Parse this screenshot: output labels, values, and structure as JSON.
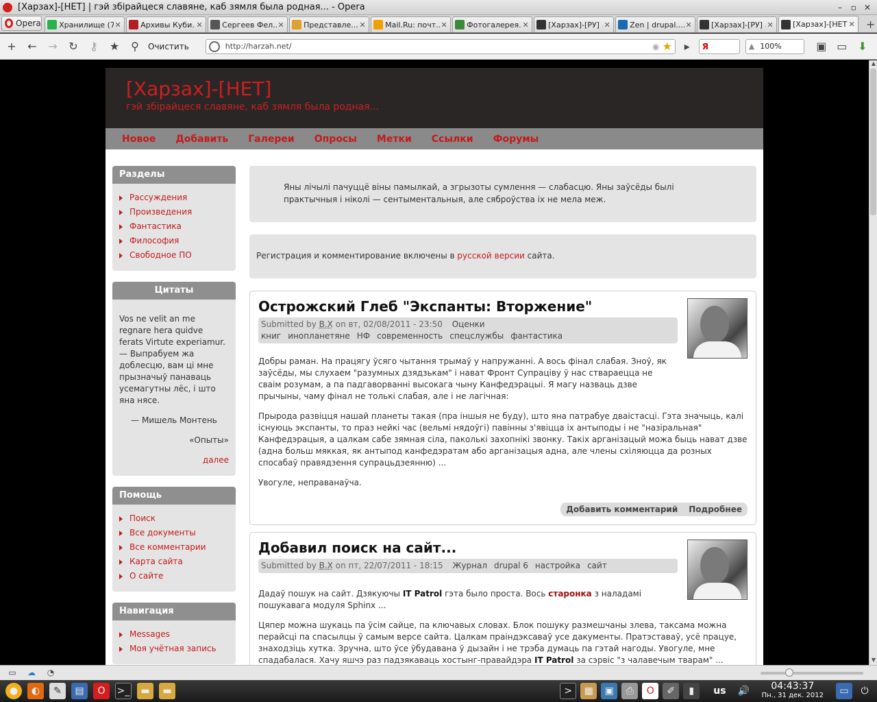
{
  "window": {
    "title": "[Харзах]-[НЕТ] | гэй збірайцеся славяне, каб зямля была родная... - Opera"
  },
  "browser": {
    "menu_label": "Opera",
    "tabs": [
      {
        "label": "Хранилище (7)",
        "color": "#2bb24c"
      },
      {
        "label": "Архивы Куби...",
        "color": "#b02020"
      },
      {
        "label": "Сергеев Фел...",
        "color": "#555555"
      },
      {
        "label": "Представле...",
        "color": "#e0a030"
      },
      {
        "label": "Mail.Ru: почт...",
        "color": "#f0a000"
      },
      {
        "label": "Фотогалерея...",
        "color": "#3a8a3a"
      },
      {
        "label": "[Харзах]-[РУ] ...",
        "color": "#333333"
      },
      {
        "label": "Zen | drupal....",
        "color": "#1a6ab0"
      },
      {
        "label": "[Харзах]-[РУ] ...",
        "color": "#333333"
      },
      {
        "label": "[Харзах]-[НЕТ...",
        "color": "#333333",
        "active": true
      }
    ],
    "toolbar": {
      "clear_label": "Очистить",
      "url": "http://harzah.net/",
      "search_engine": "Я",
      "zoom": "100%"
    }
  },
  "site": {
    "title": "[Харзах]-[НЕТ]",
    "slogan": "гэй збірайцеся славяне, каб зямля была родная...",
    "nav": [
      "Новое",
      "Добавить",
      "Галереи",
      "Опросы",
      "Метки",
      "Ссылки",
      "Форумы"
    ]
  },
  "sidebar": {
    "sections": {
      "title": "Разделы",
      "items": [
        "Рассуждения",
        "Произведения",
        "Фантастика",
        "Философия",
        "Свободное ПО"
      ]
    },
    "quotes": {
      "title": "Цитаты",
      "text": "Vos ne velit an me regnare hera quidve ferats Virtute experiamur. — Выпрабуем жа доблесцю, вам ці мне прызначыў панаваць усемагутны лёс, і што яна нясе.",
      "author": "— Мишель Монтень",
      "source": "«Опыты»",
      "more": "далее"
    },
    "help": {
      "title": "Помощь",
      "items": [
        "Поиск",
        "Все документы",
        "Все комментарии",
        "Карта сайта",
        "О сайте"
      ]
    },
    "navigation": {
      "title": "Навигация",
      "items": [
        "Messages",
        "Моя учётная запись"
      ]
    }
  },
  "messages": {
    "quote": "Яны лічылі пачуццё віны памылкай, а згрызоты сумлення — слабасцю. Яны заўсёды былі практычныя і ніколі — сентыментальныя, але сяброўства іх не мела меж.",
    "registration_before": "Регистрация и комментирование включены в ",
    "registration_link": "русской версии",
    "registration_after": " сайта."
  },
  "nodes": [
    {
      "title": "Острожский Глеб \"Экспанты: Вторжение\"",
      "submitted_by": "Submitted by ",
      "author": "B.X",
      "date": " on вт, 02/08/2011 - 23:50",
      "tags": [
        "Оценки книг",
        "инопланетяне",
        "НФ",
        "современность",
        "спецслужбы",
        "фантастика"
      ],
      "paragraphs": [
        "Добры раман. На працягу ўсяго чытання трымаў у напружанні. А вось фінал слабая. Зноў, як заўсёды, мы слухаем \"разумных дзядзькам\" і нават Фронт Супраціву ў нас ствараецца не сваім розумам, а па падгаворванні высокага чыну Канфедэрацыі. Я магу назваць дзве прычыны, чаму фінал не толькі слабая, але і не лагічная:",
        "Прырода развіцця нашай планеты такая (пра іншыя не буду), што яна патрабуе дваістасці. Гэта значыць, калі існуюць экспанты, то праз нейкі час (вельмі нядоўгі) павінны з'явіцца іх антыподы і не \"назіральная\" Канфедэрацыя, а цалкам сабе зямная сіла, паколькі захопнікі звонку. Такіх арганізацый можа быць нават дзве (адна больш мяккая, як антыпод канфедэратам або арганізацыя адна, але члены схіляюцца да розных спосабаў правядзення супрацьдзеянню) ...",
        "Увогуле, неправанаўча."
      ],
      "links": [
        "Добавить комментарий",
        "Подробнее"
      ]
    },
    {
      "title": "Добавил поиск на сайт...",
      "submitted_by": "Submitted by ",
      "author": "B.X",
      "date": " on пт, 22/07/2011 - 18:15",
      "tags": [
        "Журнал",
        "drupal 6",
        "настройка",
        "сайт"
      ],
      "p1_before": "Дадаў пошук на сайт. Дзякуючы ",
      "p1_bold": "IT Patrol",
      "p1_mid": " гэта было проста. Вось ",
      "p1_link": "старонка",
      "p1_after": " з наладамі пошукавага модуля Sphinx ...",
      "p2_before": "Цяпер можна шукаць па ўсім сайце, па ключавых словах. Блок пошуку размешчаны злева, таксама можна перайсці па спасылцы ў самым версе сайта. Цалкам праіндэксаваў усе дакументы. Пратэставаў, усё працуе, знаходзіць хутка. Зручна, што ўсе ўбудавана ў дызайн і не трэба думаць па гэтай нагоды. Увогуле, мне спадабалася. Хачу яшчэ раз падзякаваць хостынг-правайдэра ",
      "p2_bold": "IT Patrol",
      "p2_after": " за сэрвіс \"з чалавечым тварам\" ..."
    }
  ],
  "taskbar": {
    "lang": "us",
    "time": "04:43:37",
    "date": "Пн., 31 дек. 2012"
  }
}
